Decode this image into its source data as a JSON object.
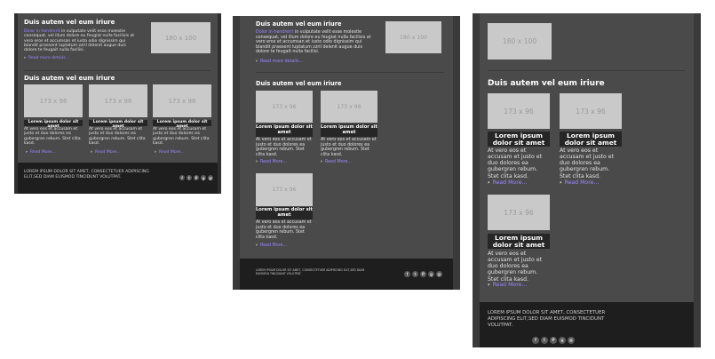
{
  "section_heading": "Duis autem vel eum iriure",
  "intro": {
    "link": "Dolor in hendrerit",
    "body": " in vulputate velit esse molestie consequat, vel illum dolore eu feugiat nulla facilisis at vero eros et accumsan et iusto odio dignissim qui blandit praesent luptatum zzril delenit augue duis dolore te feugait nulla facilisi.",
    "read_more": "Read more details..."
  },
  "image_large": "180 x 100",
  "image_small": "173 x 96",
  "card": {
    "title": "Lorem ipsum dolor sit amet",
    "body": "At vero eos et accusam et justo et duo dolores ea gubergren rebum. Stet clita kasd.",
    "read_more": "Read More..."
  },
  "footer": {
    "text": "LOREM IPSUM DOLOR SIT AMET, CONSECTETUER ADIPISCING ELIT,SED DIAM EUISMOD TINCIDUNT VOLUTPAT.",
    "social": [
      "f",
      "t",
      "P",
      "g",
      "@"
    ]
  },
  "colors": {
    "panel_bg": "#4a4a4a",
    "footer_bg": "#1e1e1e",
    "link": "#9b87ff",
    "placeholder": "#c9c9c9",
    "caption_bg": "#262626"
  }
}
